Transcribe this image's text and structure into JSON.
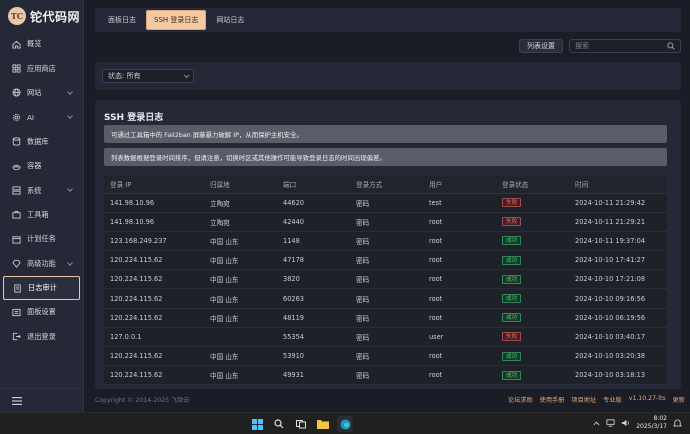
{
  "app": {
    "logo_mark": "TC",
    "logo_text": "铊代码网"
  },
  "sidebar": {
    "items": [
      {
        "label": "概览",
        "icon": "home-icon"
      },
      {
        "label": "应用商店",
        "icon": "grid-icon"
      },
      {
        "label": "网站",
        "icon": "globe-icon",
        "has_children": true
      },
      {
        "label": "AI",
        "icon": "gear-icon",
        "has_children": true
      },
      {
        "label": "数据库",
        "icon": "database-icon"
      },
      {
        "label": "容器",
        "icon": "container-icon"
      },
      {
        "label": "系统",
        "icon": "server-icon",
        "has_children": true
      },
      {
        "label": "工具箱",
        "icon": "toolbox-icon"
      },
      {
        "label": "计划任务",
        "icon": "calendar-icon"
      },
      {
        "label": "高级功能",
        "icon": "diamond-icon",
        "has_children": true
      },
      {
        "label": "日志审计",
        "icon": "log-icon",
        "active": true
      },
      {
        "label": "面板设置",
        "icon": "settings-icon"
      },
      {
        "label": "退出登录",
        "icon": "logout-icon"
      }
    ]
  },
  "tabs": [
    {
      "label": "面板日志"
    },
    {
      "label": "SSH 登录日志",
      "active": true
    },
    {
      "label": "网站日志"
    }
  ],
  "toolbar": {
    "columns_button": "列表设置",
    "search_placeholder": "搜索"
  },
  "filter": {
    "status_select": "状态: 所有"
  },
  "panel": {
    "title": "SSH 登录日志",
    "notices": [
      "可通过工具箱中的 Fail2ban 屏蔽暴力破解 IP，从而保护主机安全。",
      "列表数据根据登录时间排序，但请注意，切换时区或其他操作可能导致登录日志的时间出现偏差。"
    ]
  },
  "table": {
    "headers": [
      "登录 IP",
      "归属地",
      "端口",
      "登录方式",
      "用户",
      "登录状态",
      "时间"
    ],
    "rows": [
      {
        "ip": "141.98.10.96",
        "location": "立陶宛",
        "port": "44620",
        "method": "密码",
        "user": "test",
        "status": "失败",
        "status_type": "fail",
        "time": "2024-10-11 21:29:42"
      },
      {
        "ip": "141.98.10.96",
        "location": "立陶宛",
        "port": "42440",
        "method": "密码",
        "user": "root",
        "status": "失败",
        "status_type": "fail",
        "time": "2024-10-11 21:29:21"
      },
      {
        "ip": "123.168.249.237",
        "location": "中国 山东",
        "port": "1148",
        "method": "密码",
        "user": "root",
        "status": "成功",
        "status_type": "ok",
        "time": "2024-10-11 19:37:04"
      },
      {
        "ip": "120.224.115.62",
        "location": "中国 山东",
        "port": "47178",
        "method": "密码",
        "user": "root",
        "status": "成功",
        "status_type": "ok",
        "time": "2024-10-10 17:41:27"
      },
      {
        "ip": "120.224.115.62",
        "location": "中国 山东",
        "port": "3820",
        "method": "密码",
        "user": "root",
        "status": "成功",
        "status_type": "ok",
        "time": "2024-10-10 17:21:08"
      },
      {
        "ip": "120.224.115.62",
        "location": "中国 山东",
        "port": "60263",
        "method": "密码",
        "user": "root",
        "status": "成功",
        "status_type": "ok",
        "time": "2024-10-10 09:16:56"
      },
      {
        "ip": "120.224.115.62",
        "location": "中国 山东",
        "port": "48119",
        "method": "密码",
        "user": "root",
        "status": "成功",
        "status_type": "ok",
        "time": "2024-10-10 06:19:56"
      },
      {
        "ip": "127.0.0.1",
        "location": "",
        "port": "55354",
        "method": "密码",
        "user": "user",
        "status": "失败",
        "status_type": "fail",
        "time": "2024-10-10 03:40:17"
      },
      {
        "ip": "120.224.115.62",
        "location": "中国 山东",
        "port": "53910",
        "method": "密码",
        "user": "root",
        "status": "成功",
        "status_type": "ok",
        "time": "2024-10-10 03:20:38"
      },
      {
        "ip": "120.224.115.62",
        "location": "中国 山东",
        "port": "49931",
        "method": "密码",
        "user": "root",
        "status": "成功",
        "status_type": "ok",
        "time": "2024-10-10 03:18:13"
      }
    ]
  },
  "footer": {
    "copyright": "Copyright © 2014-2025 飞致云",
    "links": [
      "论坛求助",
      "使用手册",
      "项目地址",
      "专业版",
      "v1.10.27-lts",
      "更新"
    ]
  },
  "taskbar": {
    "time": "8:02",
    "date": "2025/3/17"
  },
  "colors": {
    "accent": "#f4c9a4",
    "success": "#4cc47e",
    "fail": "#e06a6a",
    "link": "#e0a87a"
  }
}
